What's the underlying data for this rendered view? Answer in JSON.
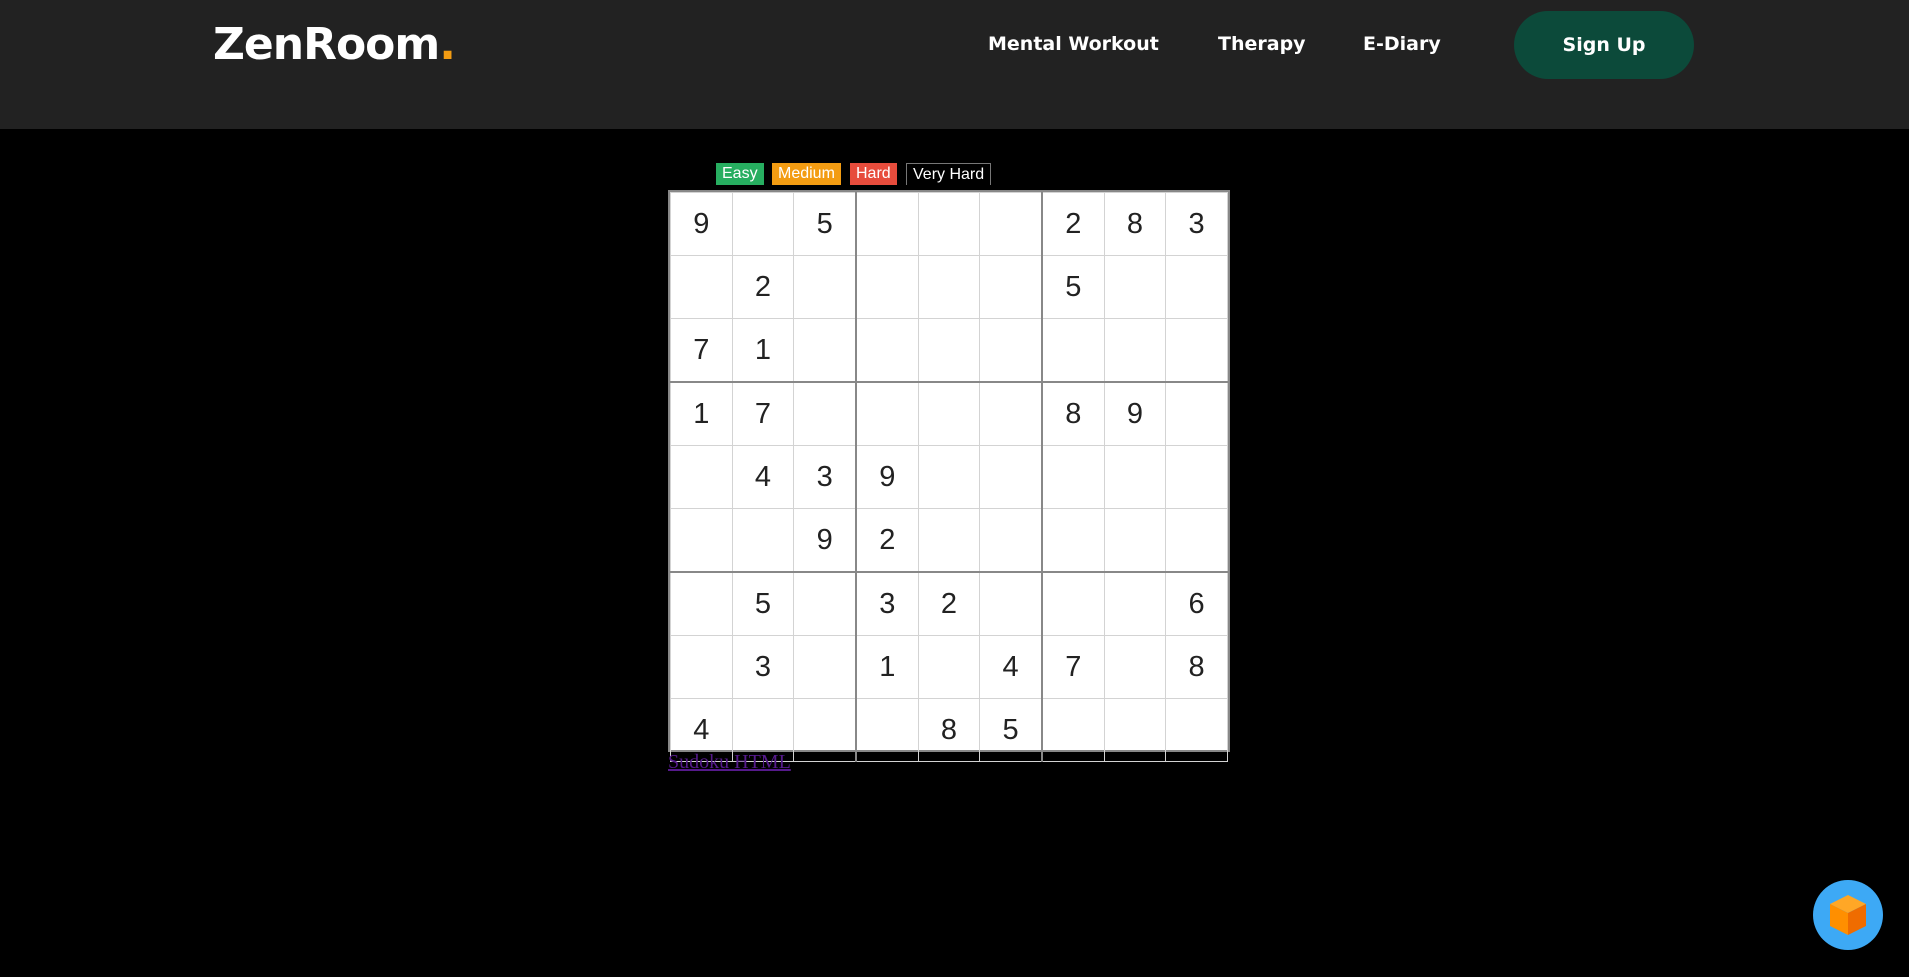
{
  "header": {
    "logo_text": "ZenRoom",
    "logo_dot": ".",
    "nav": [
      "Mental Workout",
      "Therapy",
      "E-Diary"
    ],
    "signup_label": "Sign Up"
  },
  "difficulty": {
    "easy": "Easy",
    "medium": "Medium",
    "hard": "Hard",
    "very_hard": "Very Hard"
  },
  "colors": {
    "easy": "#27ae60",
    "medium": "#f39c12",
    "hard": "#e74c3c",
    "signup_bg": "#0c4a3a",
    "logo_dot": "#f39c12",
    "fab": "#3da9f5"
  },
  "board": [
    [
      "9",
      "",
      "5",
      "",
      "",
      "",
      "2",
      "8",
      "3"
    ],
    [
      "",
      "2",
      "",
      "",
      "",
      "",
      "5",
      "",
      ""
    ],
    [
      "7",
      "1",
      "",
      "",
      "",
      "",
      "",
      "",
      ""
    ],
    [
      "1",
      "7",
      "",
      "",
      "",
      "",
      "8",
      "9",
      ""
    ],
    [
      "",
      "4",
      "3",
      "9",
      "",
      "",
      "",
      "",
      ""
    ],
    [
      "",
      "",
      "9",
      "2",
      "",
      "",
      "",
      "",
      ""
    ],
    [
      "",
      "5",
      "",
      "3",
      "2",
      "",
      "",
      "",
      "6"
    ],
    [
      "",
      "3",
      "",
      "1",
      "",
      "4",
      "7",
      "",
      "8"
    ],
    [
      "4",
      "",
      "",
      "",
      "8",
      "5",
      "",
      "",
      ""
    ]
  ],
  "footer_link": "Sudoku HTML",
  "fab_icon": "cube-icon"
}
